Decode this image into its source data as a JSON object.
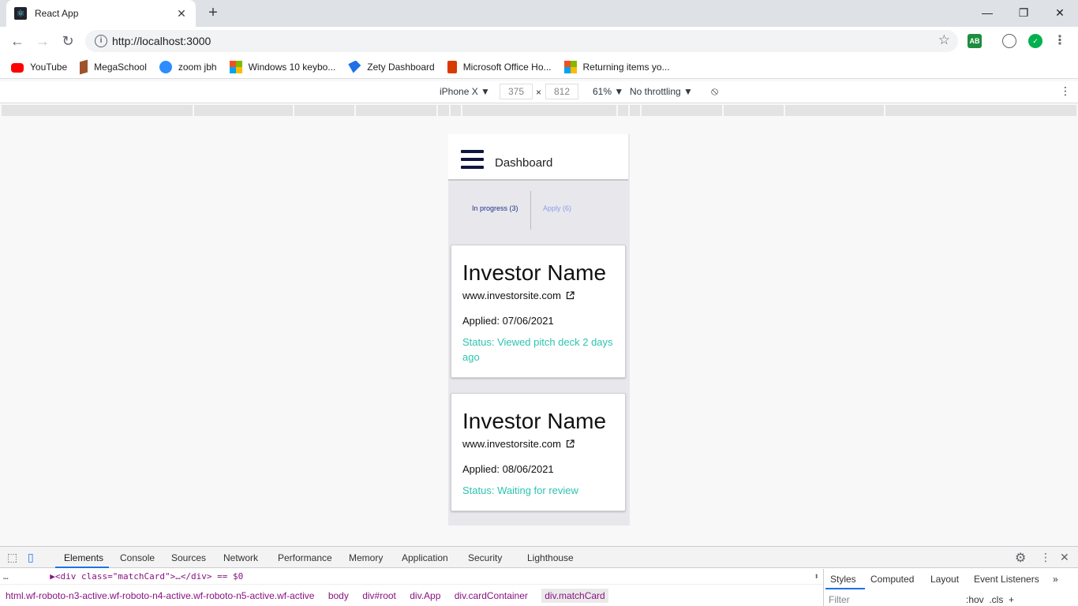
{
  "browser": {
    "tab_title": "React App",
    "tab_close": "✕",
    "new_tab": "+",
    "win_minimize": "—",
    "win_restore": "❐",
    "win_close": "✕",
    "url": "http://localhost:3000",
    "extensions": [
      "AB"
    ]
  },
  "bookmarks": [
    {
      "label": "YouTube",
      "icon": "youtube-icon"
    },
    {
      "label": "MegaSchool",
      "icon": "megaschool-icon"
    },
    {
      "label": "zoom jbh",
      "icon": "zoom-icon"
    },
    {
      "label": "Windows 10 keybo...",
      "icon": "windows-icon"
    },
    {
      "label": "Zety Dashboard",
      "icon": "zety-icon"
    },
    {
      "label": "Microsoft Office Ho...",
      "icon": "office-icon"
    },
    {
      "label": "Returning items yo...",
      "icon": "windows-icon"
    }
  ],
  "device_toolbar": {
    "device": "iPhone X ▼",
    "width": "375",
    "times": "×",
    "height": "812",
    "zoom": "61% ▼",
    "throttling": "No throttling ▼"
  },
  "app": {
    "title": "Dashboard",
    "tabs": [
      {
        "label": "In progress (3)",
        "active": true
      },
      {
        "label": "Apply (6)",
        "active": false
      }
    ],
    "cards": [
      {
        "name": "Investor Name",
        "site": "www.investorsite.com",
        "applied": "Applied: 07/06/2021",
        "status": "Status: Viewed pitch deck 2 days ago"
      },
      {
        "name": "Investor Name",
        "site": "www.investorsite.com",
        "applied": "Applied: 08/06/2021",
        "status": "Status: Waiting for review"
      }
    ]
  },
  "devtools": {
    "tabs": [
      "Elements",
      "Console",
      "Sources",
      "Network",
      "Performance",
      "Memory",
      "Application",
      "Security",
      "Lighthouse"
    ],
    "dom_line": "▶<div class=\"matchCard\">…</div> == $0",
    "breadcrumbs": [
      "html.wf-roboto-n3-active.wf-roboto-n4-active.wf-roboto-n5-active.wf-active",
      "body",
      "div#root",
      "div.App",
      "div.cardContainer",
      "div.matchCard"
    ],
    "side_tabs": [
      "Styles",
      "Computed",
      "Layout",
      "Event Listeners"
    ],
    "filter_placeholder": "Filter",
    "filter_tools": ":hov  .cls  +"
  },
  "colors": {
    "status": "#2cc4b0",
    "active_tab_text": "#1f2f8a",
    "inactive_tab_text": "#8b9ce8",
    "hamburger": "#101540"
  }
}
